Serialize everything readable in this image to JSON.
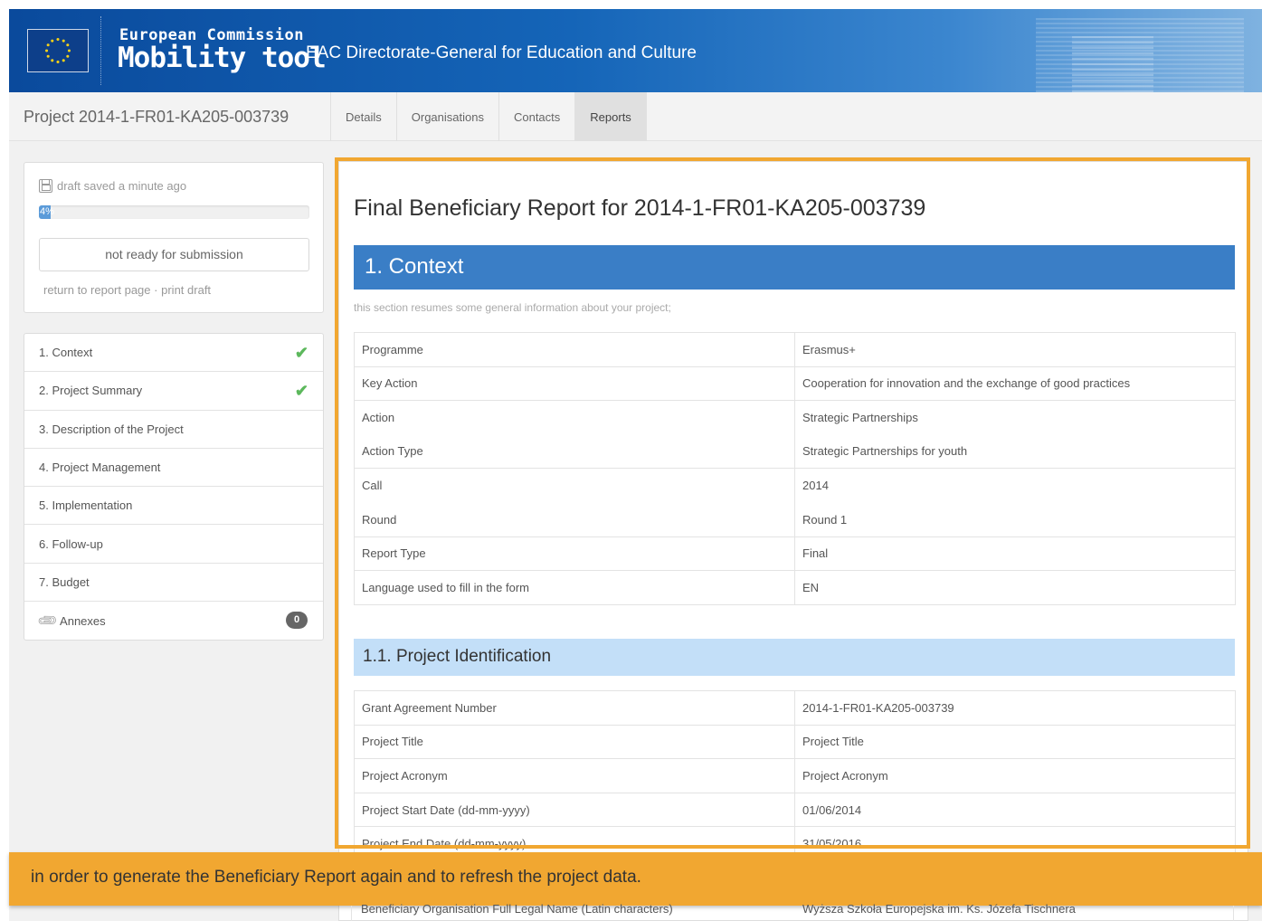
{
  "header": {
    "org": "European Commission",
    "app": "Mobility tool",
    "dg": "EAC Directorate-General for Education and Culture"
  },
  "project": {
    "title": "Project 2014-1-FR01-KA205-003739",
    "tabs": [
      "Details",
      "Organisations",
      "Contacts",
      "Reports"
    ],
    "active_tab": "Reports"
  },
  "status": {
    "draft_saved": "draft saved a minute ago",
    "progress_label": "4%",
    "progress_fraction": 0.04,
    "submit_label": "not ready for submission",
    "return_link": "return to report page",
    "separator": "·",
    "print_link": "print draft"
  },
  "nav": {
    "items": [
      {
        "label": "1. Context",
        "done": true
      },
      {
        "label": "2. Project Summary",
        "done": true
      },
      {
        "label": "3. Description of the Project",
        "done": false
      },
      {
        "label": "4. Project Management",
        "done": false
      },
      {
        "label": "5. Implementation",
        "done": false
      },
      {
        "label": "6. Follow-up",
        "done": false
      },
      {
        "label": "7. Budget",
        "done": false
      }
    ],
    "annexes_label": "Annexes",
    "annexes_count": "0"
  },
  "report": {
    "title": "Final Beneficiary Report for 2014-1-FR01-KA205-003739",
    "section": "1. Context",
    "section_desc": "this section resumes some general information about your project;",
    "context_rows": [
      {
        "label": "Programme",
        "value": "Erasmus+"
      },
      {
        "label": "Key Action",
        "value": "Cooperation for innovation and the exchange of good practices"
      },
      {
        "label": "Action",
        "value": "Strategic Partnerships"
      },
      {
        "label": "Action Type",
        "value": "Strategic Partnerships for youth"
      },
      {
        "label": "Call",
        "value": "2014"
      },
      {
        "label": "Round",
        "value": "Round 1"
      },
      {
        "label": "Report Type",
        "value": "Final"
      },
      {
        "label": "Language used to fill in the form",
        "value": "EN"
      }
    ],
    "subsection": "1.1. Project Identification",
    "ident_rows": [
      {
        "label": "Grant Agreement Number",
        "value": "2014-1-FR01-KA205-003739"
      },
      {
        "label": "Project Title",
        "value": "Project Title"
      },
      {
        "label": "Project Acronym",
        "value": "Project Acronym"
      },
      {
        "label": "Project Start Date (dd-mm-yyyy)",
        "value": "01/06/2014"
      },
      {
        "label": "Project End Date (dd-mm-yyyy)",
        "value": "31/05/2016"
      }
    ],
    "partial_row": {
      "label": "Beneficiary Organisation Full Legal Name (Latin characters)",
      "value": "Wyższa Szkoła Europejska im. Ks. Józefa Tischnera"
    }
  },
  "notice": "in order to generate the Beneficiary Report again and to refresh the project data.",
  "colors": {
    "accent": "#3a7ec6",
    "highlight": "#f1a731",
    "check": "#5cb85c"
  }
}
